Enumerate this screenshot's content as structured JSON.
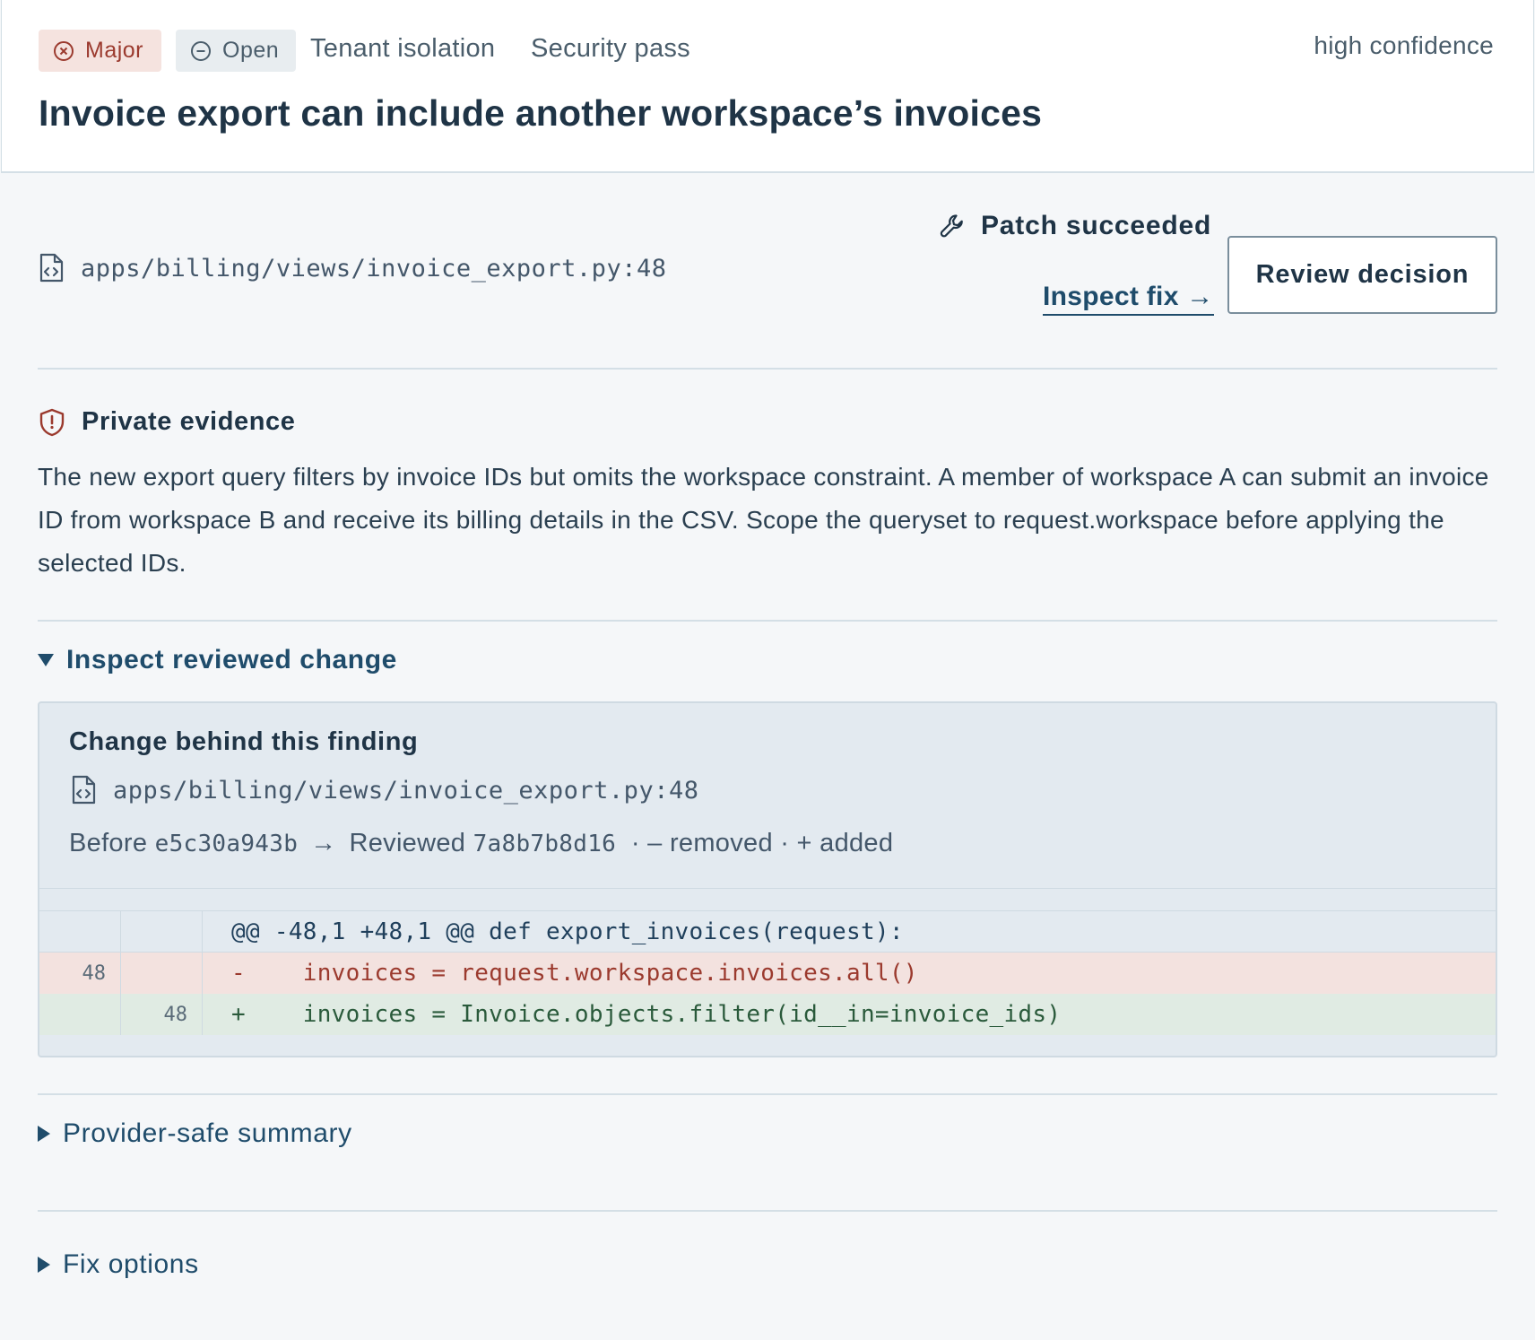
{
  "header": {
    "severity": "Major",
    "status": "Open",
    "category": "Tenant isolation",
    "pass": "Security pass",
    "confidence": "high confidence",
    "title": "Invoice export can include another workspace’s invoices"
  },
  "location": {
    "file": "apps/billing/views/invoice_export.py:48"
  },
  "patch": {
    "status": "Patch succeeded",
    "inspect_link": "Inspect fix →",
    "review_button": "Review decision"
  },
  "evidence": {
    "title": "Private evidence",
    "body": "The new export query filters by invoice IDs but omits the workspace constraint. A member of workspace A can submit an invoice ID from workspace B and receive its billing details in the CSV. Scope the queryset to request.workspace before applying the selected IDs."
  },
  "reviewed_change": {
    "toggle_label": "Inspect reviewed change",
    "panel_title": "Change behind this finding",
    "file": "apps/billing/views/invoice_export.py:48",
    "before_label": "Before",
    "before_sha": "e5c30a943b",
    "arrow": "→",
    "reviewed_label": "Reviewed",
    "reviewed_sha": "7a8b7b8d16",
    "legend": "· – removed · + added",
    "diff": {
      "hunk": "@@ -48,1 +48,1 @@ def export_invoices(request):",
      "removed": {
        "old_line": "48",
        "text": "-    invoices = request.workspace.invoices.all()"
      },
      "added": {
        "new_line": "48",
        "text": "+    invoices = Invoice.objects.filter(id__in=invoice_ids)"
      }
    }
  },
  "sections": {
    "provider_summary": "Provider-safe summary",
    "fix_options": "Fix options"
  },
  "icons": {
    "severity": "x-circle-icon",
    "status": "minus-circle-icon",
    "file": "file-code-icon",
    "patch": "wrench-icon",
    "evidence": "shield-alert-icon"
  },
  "colors": {
    "major_bg": "#f5e3df",
    "major_fg": "#9b3a2e",
    "link": "#1f4c6b",
    "removed_bg": "#f3e2df",
    "added_bg": "#e0ebe3"
  }
}
